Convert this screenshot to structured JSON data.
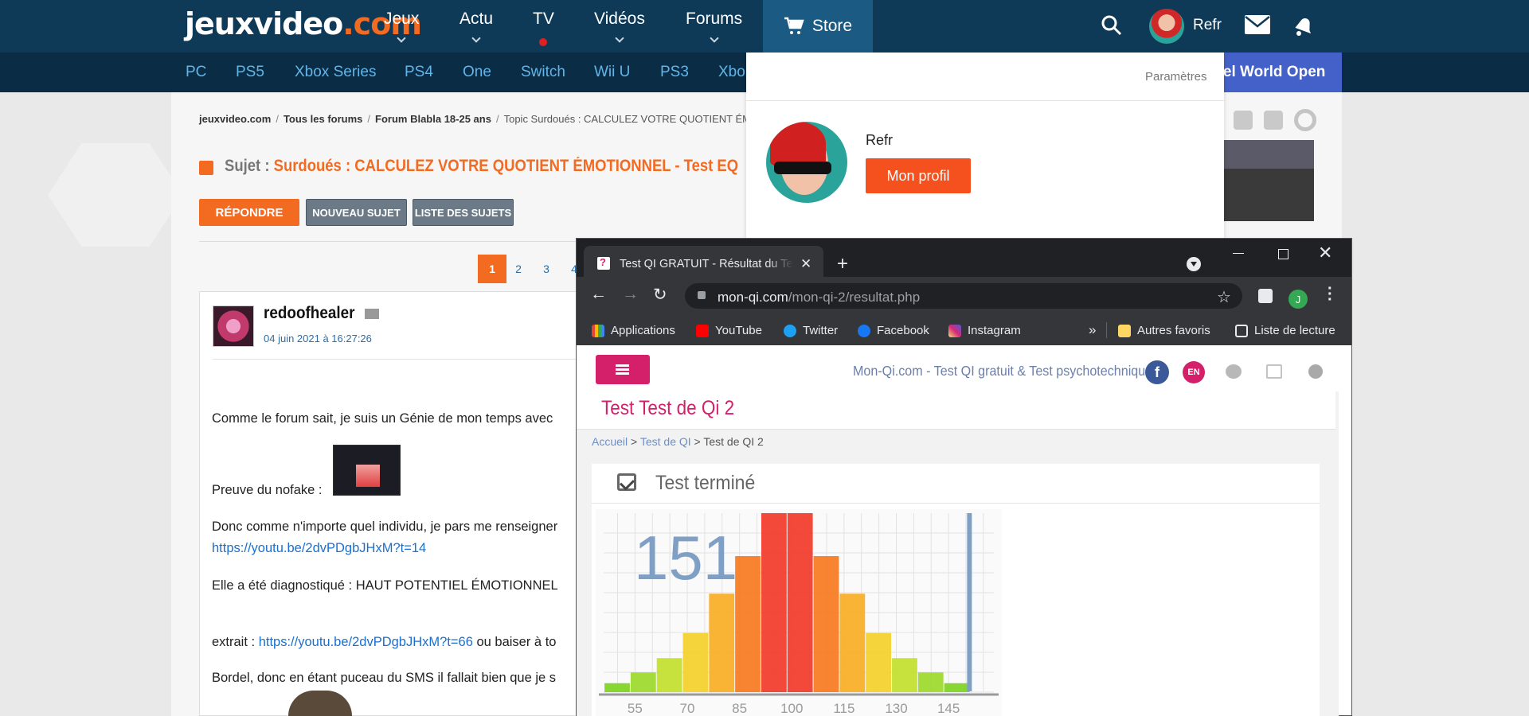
{
  "site": {
    "logo_main": "jeuxvideo",
    "logo_dot": ".com",
    "nav": [
      "Jeux",
      "Actu",
      "TV",
      "Vidéos",
      "Forums"
    ],
    "store": "Store",
    "user": "Refr",
    "subnav": [
      "PC",
      "PS5",
      "Xbox Series",
      "PS4",
      "One",
      "Switch",
      "Wii U",
      "PS3",
      "Xbo"
    ],
    "promo": "ntel World Open"
  },
  "breadcrumb": [
    "jeuxvideo.com",
    "Tous les forums",
    "Forum Blabla 18-25 ans",
    "Topic Surdoués : CALCULEZ VOTRE QUOTIENT ÉMOTIC"
  ],
  "topic": {
    "prefix": "Sujet :",
    "title": "Surdoués : CALCULEZ VOTRE QUOTIENT ÉMOTIONNEL - Test EQ"
  },
  "buttons": {
    "reply": "RÉPONDRE",
    "new_topic": "NOUVEAU SUJET",
    "list": "LISTE DES SUJETS"
  },
  "pagination": [
    "1",
    "2",
    "3",
    "4"
  ],
  "post": {
    "author": "redoofhealer",
    "date": "04 juin 2021 à 16:27:26",
    "lines": [
      "Comme le forum sait, je suis un Génie de mon temps avec",
      "Preuve du nofake :",
      "Donc comme n'importe quel individu, je pars me renseigner",
      "https://youtu.be/2dvPDgbJHxM?t=14",
      "Elle a été diagnostiqué : HAUT POTENTIEL ÉMOTIONNEL",
      "extrait : ",
      "https://youtu.be/2dvPDgbJHxM?t=66",
      " ou baiser à to",
      "Bordel, donc en étant puceau du SMS il fallait bien que je s"
    ]
  },
  "dropdown": {
    "settings": "Paramètres",
    "name": "Refr",
    "profile_button": "Mon profil"
  },
  "browser": {
    "tab_title": "Test QI GRATUIT - Résultat du Test",
    "url_domain": "mon-qi.com",
    "url_path": "/mon-qi-2/resultat.php",
    "profile_letter": "J",
    "bookmarks": [
      "Applications",
      "YouTube",
      "Twitter",
      "Facebook",
      "Instagram",
      "Autres favoris",
      "Liste de lecture"
    ],
    "bookmark_overflow": "»"
  },
  "qi": {
    "site_title": "Mon-Qi.com - Test QI gratuit & Test psychotechnique",
    "lang": "EN",
    "page_title": "Test Test de Qi 2",
    "crumb": [
      "Accueil",
      "Test de QI",
      "Test de QI 2"
    ],
    "status": "Test terminé"
  },
  "chart_data": {
    "type": "bar",
    "score_label": "151",
    "marker": 151,
    "xticks": [
      55,
      70,
      85,
      100,
      115,
      130,
      145
    ],
    "bins": [
      {
        "x": 50,
        "h": 0.05,
        "color": "#7ed321"
      },
      {
        "x": 57.5,
        "h": 0.11,
        "color": "#9bd92a"
      },
      {
        "x": 65,
        "h": 0.19,
        "color": "#c3df2c"
      },
      {
        "x": 72.5,
        "h": 0.33,
        "color": "#f4d02a"
      },
      {
        "x": 80,
        "h": 0.55,
        "color": "#f8ad24"
      },
      {
        "x": 87.5,
        "h": 0.76,
        "color": "#f7781f"
      },
      {
        "x": 95,
        "h": 1.0,
        "color": "#f23a2a"
      },
      {
        "x": 102.5,
        "h": 1.0,
        "color": "#f23a2a"
      },
      {
        "x": 110,
        "h": 0.76,
        "color": "#f7781f"
      },
      {
        "x": 117.5,
        "h": 0.55,
        "color": "#f8ad24"
      },
      {
        "x": 125,
        "h": 0.33,
        "color": "#f4d02a"
      },
      {
        "x": 132.5,
        "h": 0.19,
        "color": "#c3df2c"
      },
      {
        "x": 140,
        "h": 0.11,
        "color": "#9bd92a"
      },
      {
        "x": 147.5,
        "h": 0.05,
        "color": "#7ed321"
      }
    ],
    "xlim": [
      46,
      158
    ]
  }
}
